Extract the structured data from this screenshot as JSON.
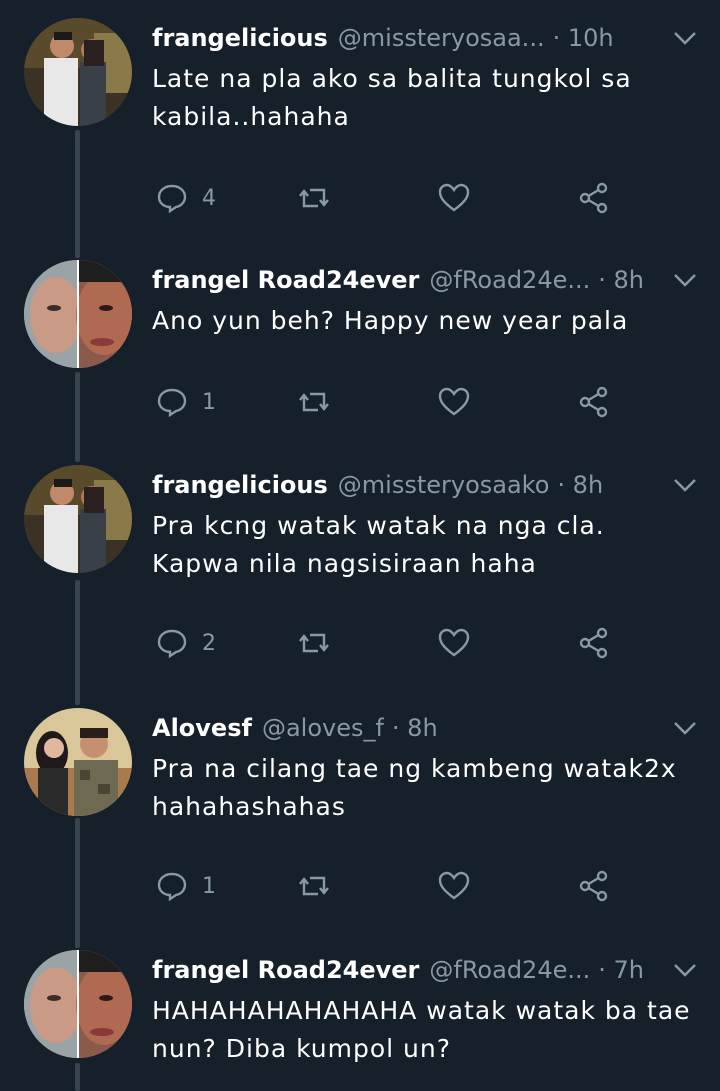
{
  "tweets": [
    {
      "name": "frangelicious",
      "handle": "@missteryosaa...",
      "time": "· 10h",
      "text": "Late na pla ako sa balita tungkol sa kabila..hahaha",
      "replies": "4",
      "avatar": "couple-photo"
    },
    {
      "name": "frangel Road24ever",
      "handle": "@fRoad24e...",
      "time": "· 8h",
      "text": "Ano yun beh? Happy new year pala",
      "replies": "1",
      "avatar": "split-face-photo"
    },
    {
      "name": "frangelicious",
      "handle": "@missteryosaako",
      "time": "· 8h",
      "text": "Pra kcng watak watak na nga cla. Kapwa nila nagsisiraan haha",
      "replies": "2",
      "avatar": "couple-photo"
    },
    {
      "name": "Alovesf",
      "handle": "@aloves_f",
      "time": "· 8h",
      "text": "Pra na cilang tae ng kambeng watak2x hahahashahas",
      "replies": "1",
      "avatar": "group-photo"
    },
    {
      "name": "frangel Road24ever",
      "handle": "@fRoad24e...",
      "time": "· 7h",
      "text": "HAHAHAHAHAHAHA watak watak ba tae nun? Diba kumpol un?",
      "replies": "",
      "avatar": "split-face-photo"
    }
  ],
  "icons": {
    "reply": "reply-icon",
    "retweet": "retweet-icon",
    "like": "heart-icon",
    "share": "share-icon",
    "caret": "chevron-down-icon"
  },
  "colors": {
    "background": "#15202b",
    "secondary_text": "#8899a6",
    "thread_line": "#38444d"
  }
}
